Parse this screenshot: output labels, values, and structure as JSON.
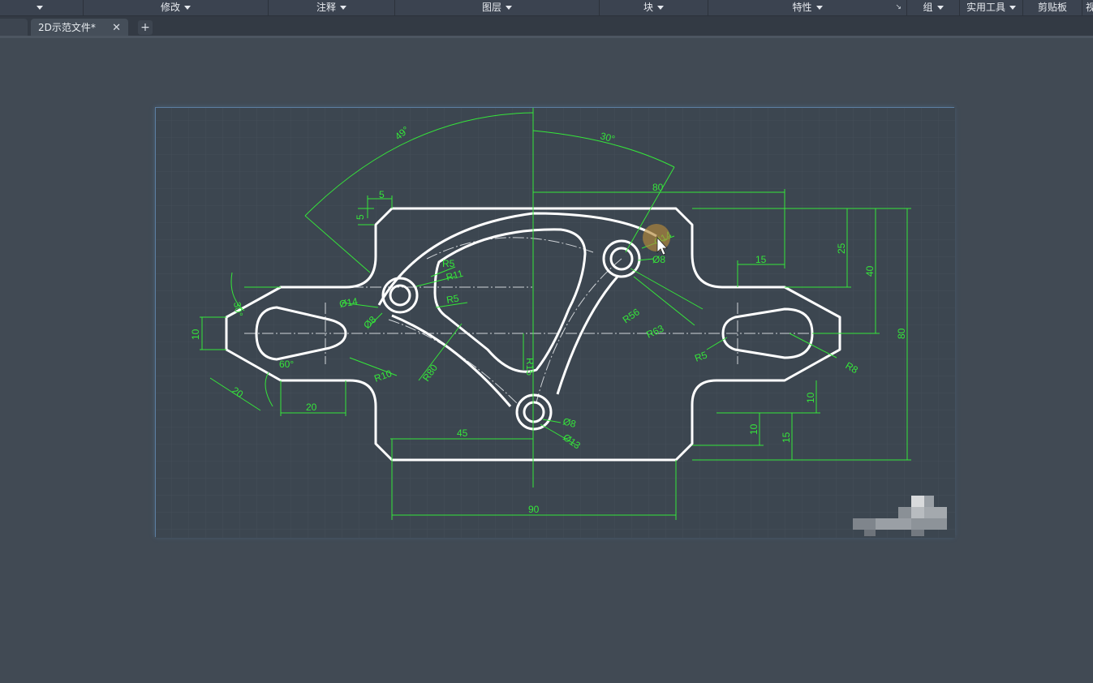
{
  "ribbon": {
    "panels": [
      {
        "label": "",
        "has_arrow": true
      },
      {
        "label": "修改",
        "has_arrow": true
      },
      {
        "label": "注释",
        "has_arrow": true
      },
      {
        "label": "图层",
        "has_arrow": true
      },
      {
        "label": "块",
        "has_arrow": true
      },
      {
        "label": "特性",
        "has_arrow": true
      },
      {
        "label": "组",
        "has_arrow": true
      },
      {
        "label": "实用工具",
        "has_arrow": true
      },
      {
        "label": "剪贴板",
        "has_arrow": false
      },
      {
        "label": "视",
        "has_arrow": false
      }
    ]
  },
  "tabs": {
    "active_label": "2D示范文件*",
    "close_glyph": "✕",
    "new_glyph": "+"
  },
  "drawing": {
    "dimensions": {
      "angle_49": "49°",
      "angle_30_top": "30°",
      "d80_top": "80",
      "d5_h": "5",
      "d5_v": "5",
      "d25": "25",
      "d40": "40",
      "d80_right": "80",
      "d15_top": "15",
      "phi14_right": "Ø14",
      "phi8_right": "Ø8",
      "r5_a": "R5",
      "r11": "R11",
      "phi14_left": "Ø14",
      "r5_b": "R5",
      "phi8_left": "Ø8",
      "angle_30_left": "30°",
      "d10_left": "10",
      "angle_60": "60°",
      "d20_slant": "20",
      "d20_h": "20",
      "r10": "R10",
      "r80": "R80",
      "r15": "R15",
      "r56": "R56",
      "r63": "R63",
      "r5_c": "R5",
      "r8": "R8",
      "d10_right": "10",
      "d10_b": "10",
      "d15_b": "15",
      "phi8_bottom": "Ø8",
      "phi13": "Ø13",
      "d45": "45",
      "d90": "90"
    }
  }
}
